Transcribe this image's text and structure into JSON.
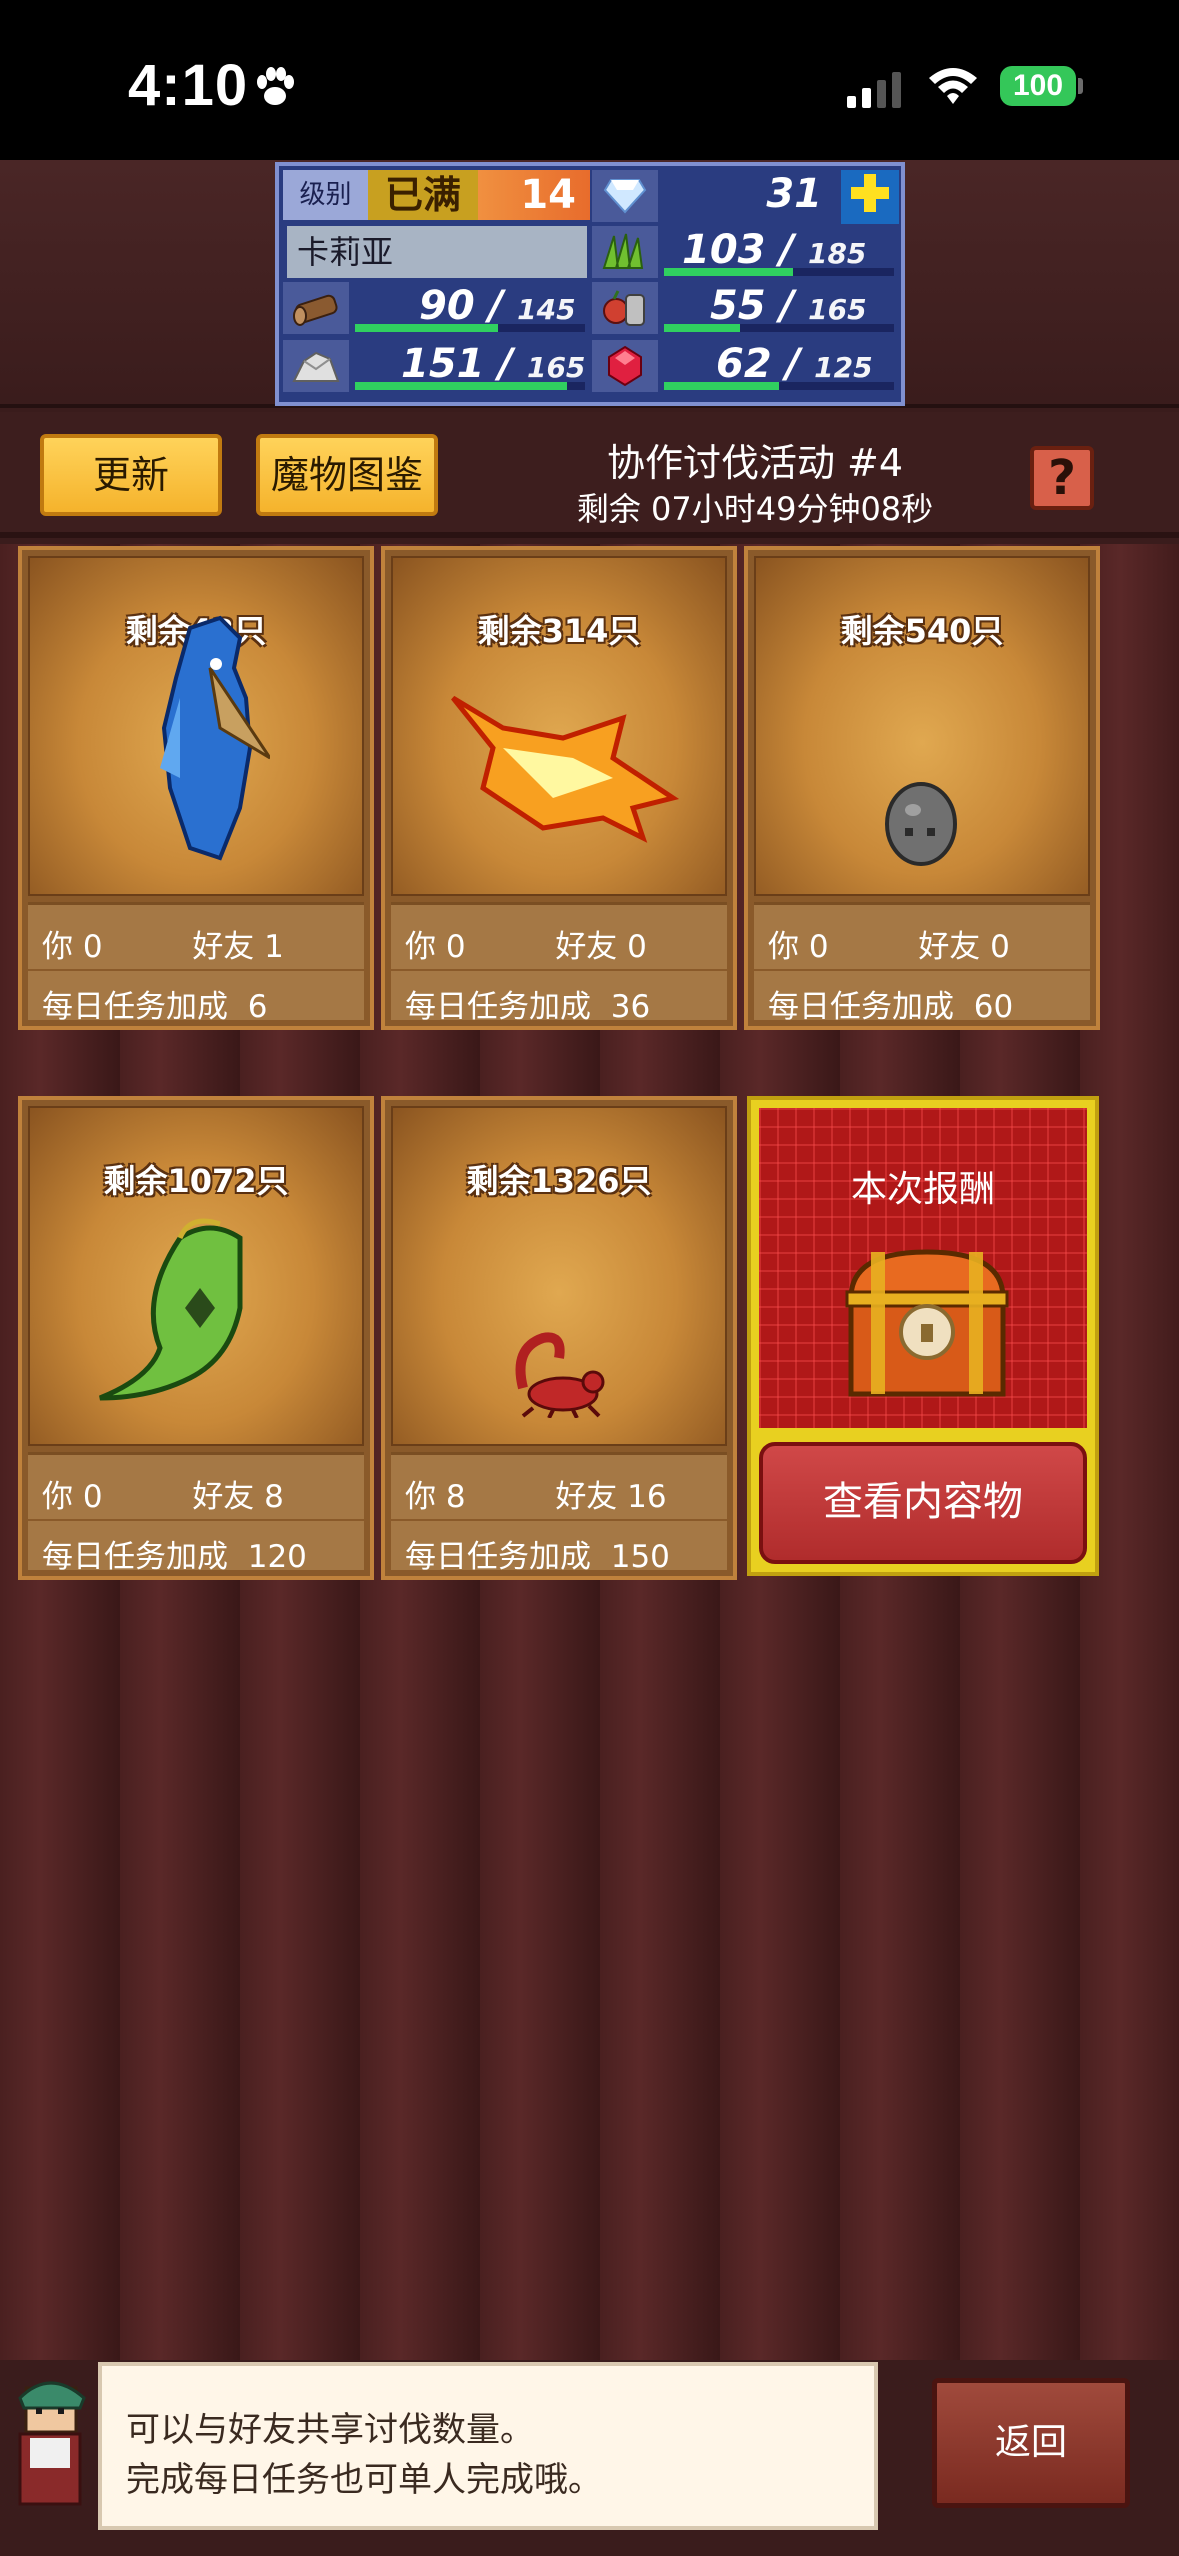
{
  "status_bar": {
    "time": "4:10",
    "battery": "100"
  },
  "stats": {
    "level_label": "级别",
    "level_max": "已满",
    "level": "14",
    "gems": "31",
    "name": "卡莉亚",
    "grass": {
      "value": "103",
      "max": "185",
      "level": 0.56
    },
    "wood": {
      "value": "90",
      "max": "145",
      "level": 0.62
    },
    "food": {
      "value": "55",
      "max": "165",
      "level": 0.33
    },
    "ore": {
      "value": "151",
      "max": "165",
      "level": 0.92
    },
    "ruby": {
      "value": "62",
      "max": "125",
      "level": 0.5
    }
  },
  "header": {
    "refresh_label": "更新",
    "bestiary_label": "魔物图鉴",
    "event_title": "协作讨伐活动 #4",
    "event_timer": "剩余 07小时49分钟08秒",
    "help_label": "?"
  },
  "labels": {
    "you": "你",
    "friends": "好友",
    "daily_bonus": "每日任务加成"
  },
  "monsters": [
    {
      "remaining": "剩余43只",
      "you": "0",
      "friends": "1",
      "bonus": "6",
      "icon": "blue-bird-monster-icon"
    },
    {
      "remaining": "剩余314只",
      "you": "0",
      "friends": "0",
      "bonus": "36",
      "icon": "fire-shark-monster-icon"
    },
    {
      "remaining": "剩余540只",
      "you": "0",
      "friends": "0",
      "bonus": "60",
      "icon": "rock-monster-icon"
    },
    {
      "remaining": "剩余1072只",
      "you": "0",
      "friends": "8",
      "bonus": "120",
      "icon": "leaf-monster-icon"
    },
    {
      "remaining": "剩余1326只",
      "you": "8",
      "friends": "16",
      "bonus": "150",
      "icon": "scorpion-monster-icon"
    }
  ],
  "reward": {
    "title": "本次报酬",
    "view_label": "查看内容物"
  },
  "dialogue": {
    "line1": "可以与好友共享讨伐数量。",
    "line2": "完成每日任务也可单人完成哦。"
  },
  "back_label": "返回"
}
